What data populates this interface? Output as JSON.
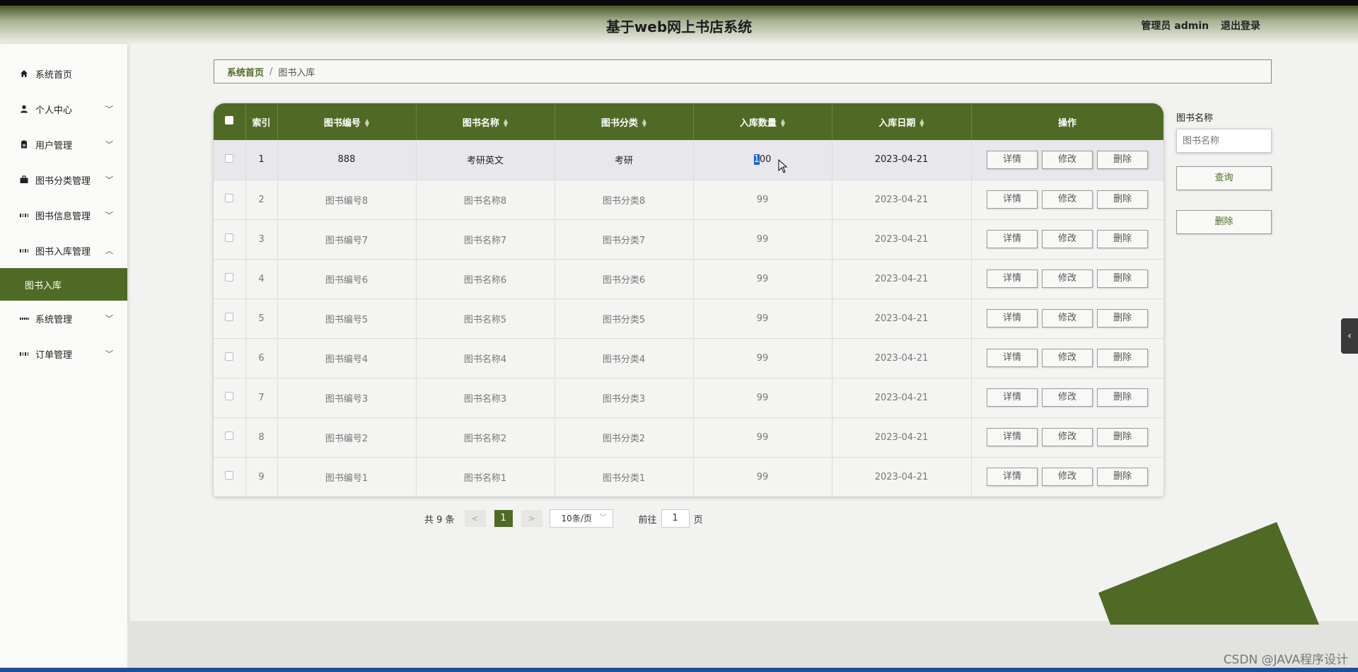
{
  "header": {
    "title": "基于web网上书店系统",
    "user_label": "管理员 admin",
    "logout_label": "退出登录"
  },
  "sidebar": {
    "items": [
      {
        "label": "系统首页"
      },
      {
        "label": "个人中心"
      },
      {
        "label": "用户管理"
      },
      {
        "label": "图书分类管理"
      },
      {
        "label": "图书信息管理"
      },
      {
        "label": "图书入库管理"
      },
      {
        "label": "图书入库"
      },
      {
        "label": "系统管理"
      },
      {
        "label": "订单管理"
      }
    ]
  },
  "breadcrumb": {
    "home": "系统首页",
    "separator": "/",
    "current": "图书入库"
  },
  "table": {
    "columns": [
      "索引",
      "图书编号",
      "图书名称",
      "图书分类",
      "入库数量",
      "入库日期",
      "操作"
    ],
    "rows": [
      {
        "index": "1",
        "book_no": "888",
        "book_name": "考研英文",
        "category": "考研",
        "qty": "100",
        "date": "2023-04-21"
      },
      {
        "index": "2",
        "book_no": "图书编号8",
        "book_name": "图书名称8",
        "category": "图书分类8",
        "qty": "99",
        "date": "2023-04-21"
      },
      {
        "index": "3",
        "book_no": "图书编号7",
        "book_name": "图书名称7",
        "category": "图书分类7",
        "qty": "99",
        "date": "2023-04-21"
      },
      {
        "index": "4",
        "book_no": "图书编号6",
        "book_name": "图书名称6",
        "category": "图书分类6",
        "qty": "99",
        "date": "2023-04-21"
      },
      {
        "index": "5",
        "book_no": "图书编号5",
        "book_name": "图书名称5",
        "category": "图书分类5",
        "qty": "99",
        "date": "2023-04-21"
      },
      {
        "index": "6",
        "book_no": "图书编号4",
        "book_name": "图书名称4",
        "category": "图书分类4",
        "qty": "99",
        "date": "2023-04-21"
      },
      {
        "index": "7",
        "book_no": "图书编号3",
        "book_name": "图书名称3",
        "category": "图书分类3",
        "qty": "99",
        "date": "2023-04-21"
      },
      {
        "index": "8",
        "book_no": "图书编号2",
        "book_name": "图书名称2",
        "category": "图书分类2",
        "qty": "99",
        "date": "2023-04-21"
      },
      {
        "index": "9",
        "book_no": "图书编号1",
        "book_name": "图书名称1",
        "category": "图书分类1",
        "qty": "99",
        "date": "2023-04-21"
      }
    ],
    "actions": [
      "详情",
      "修改",
      "删除"
    ]
  },
  "search": {
    "label": "图书名称",
    "placeholder": "图书名称",
    "query_label": "查询",
    "delete_label": "删除"
  },
  "pager": {
    "total": "共 9 条",
    "prev": "<",
    "current": "1",
    "next": ">",
    "page_size": "10条/页",
    "goto": "前往",
    "goto_value": "1",
    "page_suffix": "页"
  },
  "watermark": "CSDN @JAVA程序设计",
  "colors": {
    "accent": "#4f6a24",
    "header_dark": "#4a5a2a"
  }
}
